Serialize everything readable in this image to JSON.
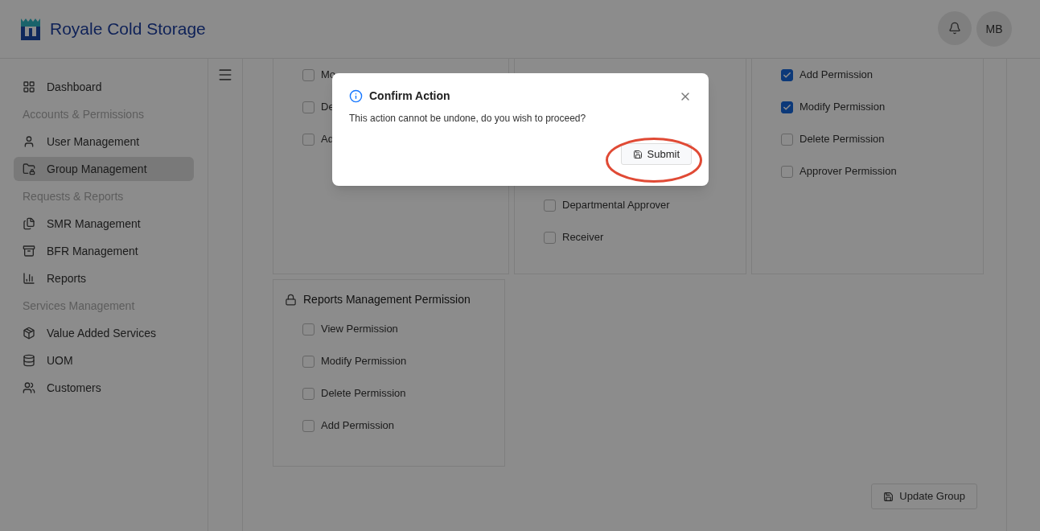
{
  "header": {
    "brand": "Royale Cold Storage",
    "avatar": "MB"
  },
  "sidebar": {
    "items": [
      {
        "kind": "link",
        "label": "Dashboard",
        "selected": false
      },
      {
        "kind": "section",
        "label": "Accounts & Permissions"
      },
      {
        "kind": "link",
        "label": "User Management",
        "selected": false
      },
      {
        "kind": "link",
        "label": "Group Management",
        "selected": true
      },
      {
        "kind": "section",
        "label": "Requests & Reports"
      },
      {
        "kind": "link",
        "label": "SMR Management",
        "selected": false
      },
      {
        "kind": "link",
        "label": "BFR Management",
        "selected": false
      },
      {
        "kind": "link",
        "label": "Reports",
        "selected": false
      },
      {
        "kind": "section",
        "label": "Services Management"
      },
      {
        "kind": "link",
        "label": "Value Added Services",
        "selected": false
      },
      {
        "kind": "link",
        "label": "UOM",
        "selected": false
      },
      {
        "kind": "link",
        "label": "Customers",
        "selected": false
      }
    ]
  },
  "permission_cards": [
    {
      "rows": [
        {
          "label": "Mo",
          "checked": false
        },
        {
          "label": "De",
          "checked": false
        },
        {
          "label": "Ad",
          "checked": false
        }
      ]
    },
    {
      "rows": [
        {
          "label": "Departmental Approver",
          "checked": false
        },
        {
          "label": "Receiver",
          "checked": false
        }
      ]
    },
    {
      "rows": [
        {
          "label": "Add Permission",
          "checked": true
        },
        {
          "label": "Modify Permission",
          "checked": true
        },
        {
          "label": "Delete Permission",
          "checked": false
        },
        {
          "label": "Approver Permission",
          "checked": false
        }
      ]
    },
    {
      "title": "Reports Management Permission",
      "rows": [
        {
          "label": "View Permission",
          "checked": false
        },
        {
          "label": "Modify Permission",
          "checked": false
        },
        {
          "label": "Delete Permission",
          "checked": false
        },
        {
          "label": "Add Permission",
          "checked": false
        }
      ]
    }
  ],
  "update_button": "Update Group",
  "dialog": {
    "title": "Confirm Action",
    "message": "This action cannot be undone, do you wish to proceed?",
    "submit": "Submit"
  }
}
